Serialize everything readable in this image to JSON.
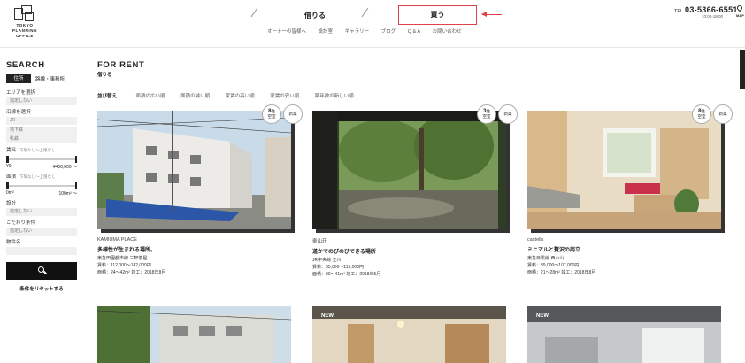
{
  "header": {
    "logo_lines": [
      "TOKYO",
      "PLANNING",
      "OFFICE"
    ],
    "nav_rent": "借りる",
    "nav_buy": "買う",
    "subnav": [
      "オーナーの皆様へ",
      "設計室",
      "ギャラリー",
      "ブログ",
      "Q & A",
      "お問い合わせ"
    ],
    "tel_label": "TEL",
    "tel_number": "03-5366-6551",
    "tel_hours": "10:00-18:00",
    "map_label": "MAP",
    "accent_color": "#e0424a"
  },
  "sidebar": {
    "title": "SEARCH",
    "tab_active": "住所",
    "tab_other": "路線・事務所",
    "area_label": "エリアを選択",
    "area_value": "指定しない",
    "line_label": "沿線を選択",
    "line_options": [
      "JR",
      "地下鉄",
      "私鉄"
    ],
    "rent_label": "賃料",
    "rent_note": "下限なし～上限なし",
    "rent_min": "¥0",
    "rent_max": "¥400,000 ～",
    "area_size_label": "面積",
    "area_size_note": "下限なし～上限なし",
    "area_min": "0m²",
    "area_max": "100m² ～",
    "layout_label": "設計",
    "layout_value": "指定しない",
    "pref_label": "こだわり条件",
    "pref_value": "指定しない",
    "name_label": "物件名",
    "reset": "条件をリセットする"
  },
  "main": {
    "title": "FOR RENT",
    "subtitle": "借りる",
    "sort_label": "並び替え",
    "sort_options": [
      "面積の広い順",
      "面積の狭い順",
      "家賃の高い順",
      "家賃の安い順",
      "築年数の新しい順"
    ]
  },
  "cards": [
    {
      "badge_num": "8",
      "badge_unit": "住",
      "badge_sub": "空室",
      "new_label": "新築",
      "name": "KAMIUMA PLACE",
      "catch": "多様性が生まれる場所。",
      "address": "東急田園都市線 三軒茶屋",
      "rent": "賃料：112,000～142,000円",
      "size": "面積：24～42m²  竣工：2018年8月"
    },
    {
      "badge_num": "3",
      "badge_unit": "住",
      "badge_sub": "空室",
      "new_label": "新築",
      "name": "楽山荘",
      "catch": "道かでのびのびできる場所",
      "address": "JR中央線 立川",
      "rent": "賃料：85,000～115,000円",
      "size": "面積：30～41m²  竣工：2018年5月"
    },
    {
      "badge_num": "8",
      "badge_unit": "住",
      "badge_sub": "空室",
      "new_label": "新築",
      "name": "castells",
      "catch": "ミニマルと贅沢の両立",
      "address": "東急目黒線 西小山",
      "rent": "賃料：89,000～107,000円",
      "size": "面積：21～28m²  竣工：2018年8月"
    },
    {
      "tag": ""
    },
    {
      "tag": "NEW"
    },
    {
      "tag": "NEW"
    }
  ]
}
